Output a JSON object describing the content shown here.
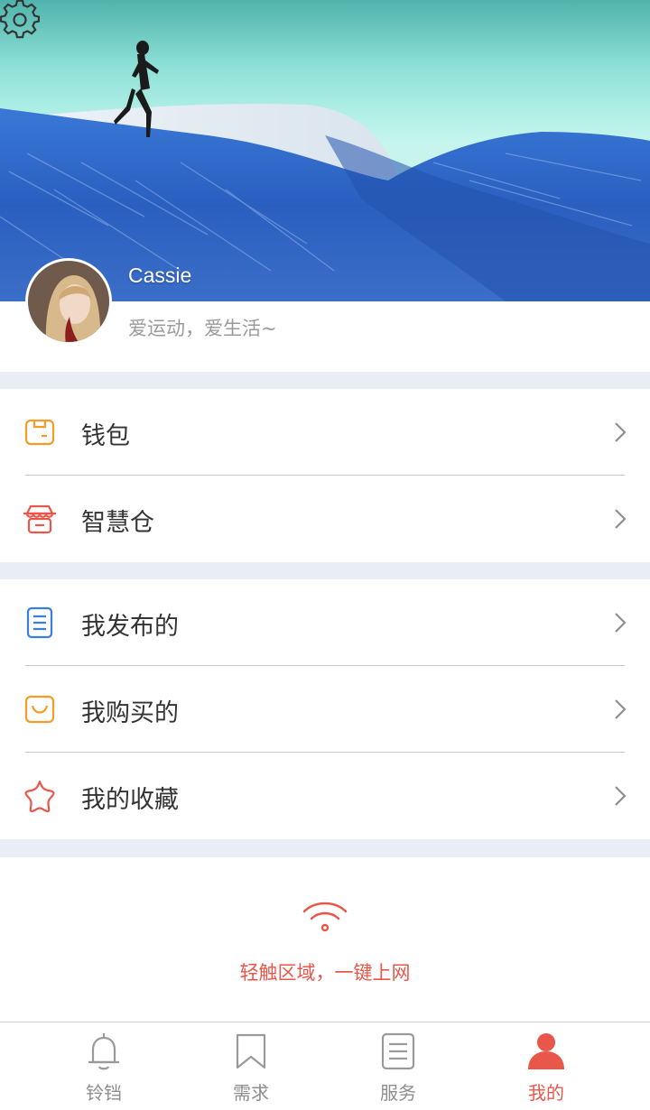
{
  "profile": {
    "username": "Cassie",
    "bio": "爱运动，爱生活~"
  },
  "menu_group_1": [
    {
      "label": "钱包",
      "icon": "wallet-icon",
      "color": "#f39c2a"
    },
    {
      "label": "智慧仓",
      "icon": "store-icon",
      "color": "#e8574a"
    }
  ],
  "menu_group_2": [
    {
      "label": "我发布的",
      "icon": "document-icon",
      "color": "#3a7ee0"
    },
    {
      "label": "我购买的",
      "icon": "shopping-bag-icon",
      "color": "#f39c2a"
    },
    {
      "label": "我的收藏",
      "icon": "star-icon",
      "color": "#e8574a"
    }
  ],
  "wifi": {
    "label": "轻触区域，一键上网",
    "icon": "wifi-icon",
    "color": "#e8574a"
  },
  "tabbar": [
    {
      "label": "铃铛",
      "icon": "bell-icon",
      "active": false
    },
    {
      "label": "需求",
      "icon": "bookmark-icon",
      "active": false
    },
    {
      "label": "服务",
      "icon": "list-icon",
      "active": false
    },
    {
      "label": "我的",
      "icon": "person-icon",
      "active": true
    }
  ],
  "colors": {
    "accent": "#e8574a",
    "section_gap": "#e9edf6",
    "tab_inactive": "#8e8e8e"
  }
}
